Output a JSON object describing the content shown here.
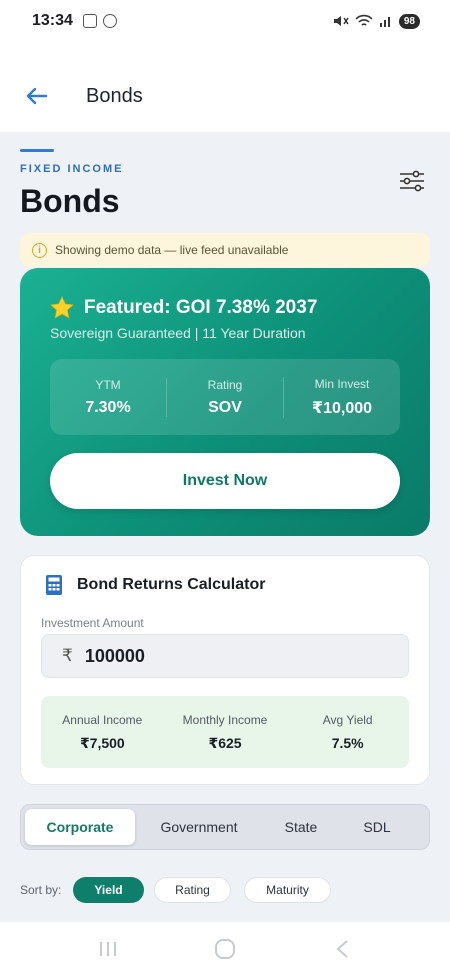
{
  "status_bar": {
    "time": "13:34",
    "battery": "98"
  },
  "app_bar": {
    "title": "Bonds"
  },
  "header": {
    "eyebrow": "FIXED INCOME",
    "title": "Bonds"
  },
  "notice": {
    "icon": "info-icon",
    "text": "Showing demo data — live feed unavailable"
  },
  "featured": {
    "icon": "star-icon",
    "title": "Featured: GOI 7.38% 2037",
    "subtitle": "Sovereign Guaranteed | 11 Year Duration",
    "stats": [
      {
        "label": "YTM",
        "value": "7.30%"
      },
      {
        "label": "Rating",
        "value": "SOV"
      },
      {
        "label": "Min Invest",
        "value": "₹10,000"
      }
    ],
    "cta": "Invest Now"
  },
  "calculator": {
    "icon": "calculator-icon",
    "title": "Bond Returns Calculator",
    "input_label": "Investment Amount",
    "currency": "₹",
    "amount": "100000",
    "results": [
      {
        "label": "Annual Income",
        "value": "₹7,500"
      },
      {
        "label": "Monthly Income",
        "value": "₹625"
      },
      {
        "label": "Avg Yield",
        "value": "7.5%"
      }
    ]
  },
  "tabs": [
    {
      "label": "Corporate",
      "active": true
    },
    {
      "label": "Government",
      "active": false
    },
    {
      "label": "State",
      "active": false
    },
    {
      "label": "SDL",
      "active": false
    }
  ],
  "sort": {
    "label": "Sort by:",
    "options": [
      {
        "label": "Yield",
        "active": true
      },
      {
        "label": "Rating",
        "active": false
      },
      {
        "label": "Maturity",
        "active": false
      }
    ]
  },
  "colors": {
    "primary": "#0e7f6a",
    "accent_blue": "#2e7cd6",
    "notice_bg": "#fdf6dc"
  }
}
